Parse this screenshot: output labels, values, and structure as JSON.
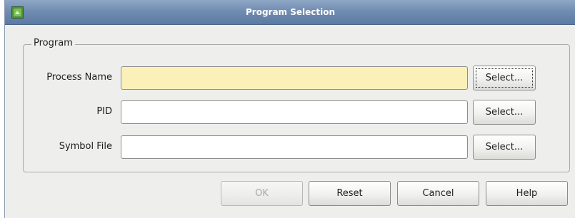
{
  "window": {
    "title": "Program Selection",
    "icon": "app-icon"
  },
  "program_group": {
    "legend": "Program",
    "fields": [
      {
        "label": "Process Name",
        "value": "",
        "select_label": "Select..."
      },
      {
        "label": "PID",
        "value": "",
        "select_label": "Select..."
      },
      {
        "label": "Symbol File",
        "value": "",
        "select_label": "Select..."
      }
    ]
  },
  "buttons": {
    "ok": "OK",
    "reset": "Reset",
    "cancel": "Cancel",
    "help": "Help"
  },
  "colors": {
    "titlebar": "#7290b6",
    "active_field": "#fbf0b8",
    "background": "#eeeeec"
  }
}
